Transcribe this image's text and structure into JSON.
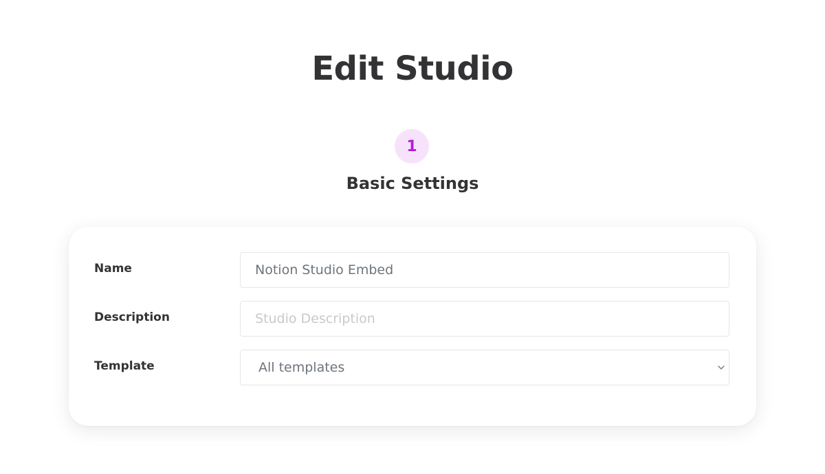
{
  "header": {
    "title": "Edit Studio"
  },
  "step": {
    "number": "1",
    "title": "Basic Settings"
  },
  "form": {
    "name": {
      "label": "Name",
      "value": "Notion Studio Embed",
      "placeholder": ""
    },
    "description": {
      "label": "Description",
      "value": "",
      "placeholder": "Studio Description"
    },
    "template": {
      "label": "Template",
      "selected": "All templates",
      "icon": "chevron-down-icon"
    }
  },
  "colors": {
    "accent": "#b21fd6",
    "accent_bg": "#f6e3fb",
    "text": "#333335",
    "field_text": "#6d747b",
    "placeholder": "#c6c9cd"
  }
}
